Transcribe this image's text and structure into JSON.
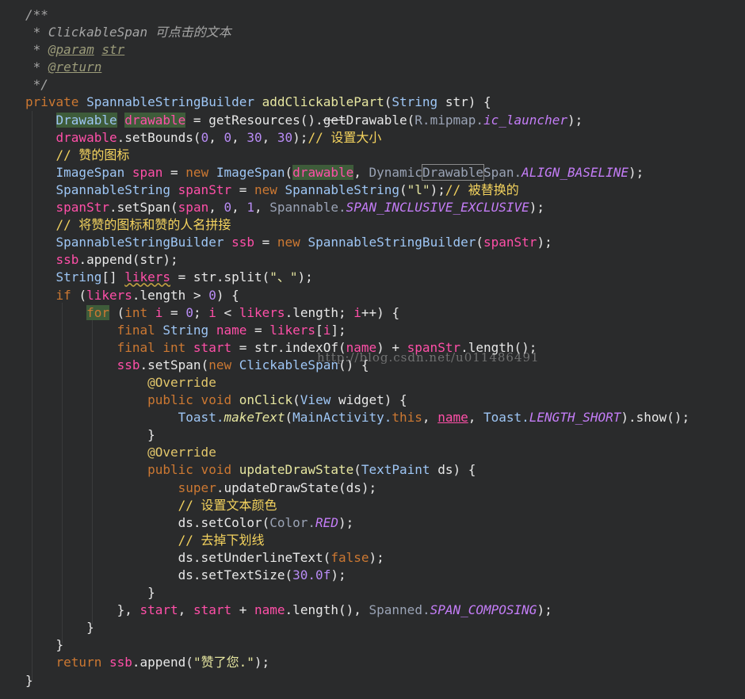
{
  "watermark": "http://blog.csdn.net/u011486491",
  "lines": [
    [
      [
        "c-doc",
        "/**"
      ]
    ],
    [
      [
        "c-doc",
        " * ClickableSpan 可点击的文本"
      ]
    ],
    [
      [
        "c-doc",
        " * "
      ],
      [
        "c-tag",
        "@param"
      ],
      [
        "c-doc",
        " "
      ],
      [
        "c-tag",
        "str"
      ]
    ],
    [
      [
        "c-doc",
        " * "
      ],
      [
        "c-tag",
        "@return"
      ]
    ],
    [
      [
        "c-doc",
        " */"
      ]
    ],
    [
      [
        "c-kw2",
        "private "
      ],
      [
        "c-type",
        "SpannableStringBuilder "
      ],
      [
        "c-fn",
        "addClickablePart"
      ],
      [
        "c-plain",
        "("
      ],
      [
        "c-type",
        "String "
      ],
      [
        "c-plain",
        "str) {"
      ]
    ],
    [
      [
        "c-plain",
        "    "
      ],
      [
        "c-type hl-green",
        "Drawable"
      ],
      [
        "c-plain",
        " "
      ],
      [
        "c-var hl-green",
        "drawable"
      ],
      [
        "c-plain",
        " = getResources()."
      ],
      [
        "c-plain strike",
        "get"
      ],
      [
        "c-plain",
        "Drawable("
      ],
      [
        "c-dim",
        "R.mipmap."
      ],
      [
        "c-const",
        "ic_launcher"
      ],
      [
        "c-plain",
        ");"
      ]
    ],
    [
      [
        "c-plain",
        "    "
      ],
      [
        "c-var",
        "drawable"
      ],
      [
        "c-plain",
        ".setBounds("
      ],
      [
        "c-num",
        "0"
      ],
      [
        "c-plain",
        ", "
      ],
      [
        "c-num",
        "0"
      ],
      [
        "c-plain",
        ", "
      ],
      [
        "c-num",
        "30"
      ],
      [
        "c-plain",
        ", "
      ],
      [
        "c-num",
        "30"
      ],
      [
        "c-plain",
        ");"
      ],
      [
        "c-cmt",
        "// 设置大小"
      ]
    ],
    [
      [
        "c-cmt",
        "    // 赞的图标"
      ]
    ],
    [
      [
        "c-plain",
        "    "
      ],
      [
        "c-type",
        "ImageSpan "
      ],
      [
        "c-var",
        "span"
      ],
      [
        "c-plain",
        " = "
      ],
      [
        "c-kw2",
        "new "
      ],
      [
        "c-type",
        "ImageSpan"
      ],
      [
        "c-plain",
        "("
      ],
      [
        "c-var hl-green",
        "drawable"
      ],
      [
        "c-plain",
        ", "
      ],
      [
        "c-dim",
        "Dynamic"
      ],
      [
        "c-dim hl-box",
        "Drawable"
      ],
      [
        "c-dim",
        "Span."
      ],
      [
        "c-const",
        "ALIGN_BASELINE"
      ],
      [
        "c-plain",
        ");"
      ]
    ],
    [
      [
        "c-plain",
        "    "
      ],
      [
        "c-type",
        "SpannableString "
      ],
      [
        "c-var",
        "spanStr"
      ],
      [
        "c-plain",
        " = "
      ],
      [
        "c-kw2",
        "new "
      ],
      [
        "c-type",
        "SpannableString"
      ],
      [
        "c-plain",
        "("
      ],
      [
        "c-str",
        "\"l\""
      ],
      [
        "c-plain",
        ");"
      ],
      [
        "c-cmt",
        "// 被替换的"
      ]
    ],
    [
      [
        "c-plain",
        "    "
      ],
      [
        "c-var",
        "spanStr"
      ],
      [
        "c-plain",
        ".setSpan("
      ],
      [
        "c-var",
        "span"
      ],
      [
        "c-plain",
        ", "
      ],
      [
        "c-num",
        "0"
      ],
      [
        "c-plain",
        ", "
      ],
      [
        "c-num",
        "1"
      ],
      [
        "c-plain",
        ", "
      ],
      [
        "c-dim",
        "Spannable."
      ],
      [
        "c-const",
        "SPAN_INCLUSIVE_EXCLUSIVE"
      ],
      [
        "c-plain",
        ");"
      ]
    ],
    [
      [
        "c-cmt",
        "    // 将赞的图标和赞的人名拼接"
      ]
    ],
    [
      [
        "c-plain",
        "    "
      ],
      [
        "c-type",
        "SpannableStringBuilder "
      ],
      [
        "c-var",
        "ssb"
      ],
      [
        "c-plain",
        " = "
      ],
      [
        "c-kw2",
        "new "
      ],
      [
        "c-type",
        "SpannableStringBuilder"
      ],
      [
        "c-plain",
        "("
      ],
      [
        "c-var",
        "spanStr"
      ],
      [
        "c-plain",
        ");"
      ]
    ],
    [
      [
        "c-plain",
        "    "
      ],
      [
        "c-var",
        "ssb"
      ],
      [
        "c-plain",
        ".append(str);"
      ]
    ],
    [
      [
        "c-plain",
        "    "
      ],
      [
        "c-type",
        "String"
      ],
      [
        "c-plain",
        "[] "
      ],
      [
        "c-var wavy",
        "likers"
      ],
      [
        "c-plain",
        " = str.split("
      ],
      [
        "c-str",
        "\"、\""
      ],
      [
        "c-plain",
        ");"
      ]
    ],
    [
      [
        "c-plain",
        "    "
      ],
      [
        "c-kw2",
        "if "
      ],
      [
        "c-plain",
        "("
      ],
      [
        "c-var",
        "likers"
      ],
      [
        "c-plain",
        ".length > "
      ],
      [
        "c-num",
        "0"
      ],
      [
        "c-plain",
        ") {"
      ]
    ],
    [
      [
        "c-plain",
        "        "
      ],
      [
        "c-kw2 hl-green",
        "for"
      ],
      [
        "c-plain",
        " ("
      ],
      [
        "c-kw2",
        "int "
      ],
      [
        "c-var",
        "i"
      ],
      [
        "c-plain",
        " = "
      ],
      [
        "c-num",
        "0"
      ],
      [
        "c-plain",
        "; "
      ],
      [
        "c-var",
        "i"
      ],
      [
        "c-plain",
        " < "
      ],
      [
        "c-var",
        "likers"
      ],
      [
        "c-plain",
        ".length; "
      ],
      [
        "c-var",
        "i"
      ],
      [
        "c-plain",
        "++) {"
      ]
    ],
    [
      [
        "c-plain",
        "            "
      ],
      [
        "c-kw2",
        "final "
      ],
      [
        "c-type",
        "String "
      ],
      [
        "c-var",
        "name"
      ],
      [
        "c-plain",
        " = "
      ],
      [
        "c-var",
        "likers"
      ],
      [
        "c-plain",
        "["
      ],
      [
        "c-var",
        "i"
      ],
      [
        "c-plain",
        "];"
      ]
    ],
    [
      [
        "c-plain",
        "            "
      ],
      [
        "c-kw2",
        "final int "
      ],
      [
        "c-var",
        "start"
      ],
      [
        "c-plain",
        " = str.indexOf("
      ],
      [
        "c-var",
        "name"
      ],
      [
        "c-plain",
        ") + "
      ],
      [
        "c-var",
        "spanStr"
      ],
      [
        "c-plain",
        ".length();"
      ]
    ],
    [
      [
        "c-plain",
        "            "
      ],
      [
        "c-var",
        "ssb"
      ],
      [
        "c-plain",
        ".setSpan("
      ],
      [
        "c-kw2",
        "new "
      ],
      [
        "c-type",
        "ClickableSpan"
      ],
      [
        "c-plain",
        "() {"
      ]
    ],
    [
      [
        "c-plain",
        "                "
      ],
      [
        "c-ann",
        "@Override"
      ]
    ],
    [
      [
        "c-plain",
        "                "
      ],
      [
        "c-kw2",
        "public void "
      ],
      [
        "c-fn",
        "onClick"
      ],
      [
        "c-plain",
        "("
      ],
      [
        "c-type",
        "View "
      ],
      [
        "c-plain",
        "widget) {"
      ]
    ],
    [
      [
        "c-plain",
        "                    "
      ],
      [
        "c-type",
        "Toast."
      ],
      [
        "c-meth c-italic",
        "makeText"
      ],
      [
        "c-plain",
        "("
      ],
      [
        "c-type",
        "MainActivity."
      ],
      [
        "c-kw2",
        "this"
      ],
      [
        "c-plain",
        ", "
      ],
      [
        "c-var under",
        "name"
      ],
      [
        "c-plain",
        ", "
      ],
      [
        "c-type",
        "Toast."
      ],
      [
        "c-const",
        "LENGTH_SHORT"
      ],
      [
        "c-plain",
        ").show();"
      ]
    ],
    [
      [
        "c-plain",
        "                }"
      ]
    ],
    [
      [
        "c-plain",
        "                "
      ],
      [
        "c-ann",
        "@Override"
      ]
    ],
    [
      [
        "c-plain",
        "                "
      ],
      [
        "c-kw2",
        "public void "
      ],
      [
        "c-fn",
        "updateDrawState"
      ],
      [
        "c-plain",
        "("
      ],
      [
        "c-type",
        "TextPaint "
      ],
      [
        "c-plain",
        "ds) {"
      ]
    ],
    [
      [
        "c-plain",
        "                    "
      ],
      [
        "c-kw2",
        "super"
      ],
      [
        "c-plain",
        ".updateDrawState(ds);"
      ]
    ],
    [
      [
        "c-cmt",
        "                    // 设置文本颜色"
      ]
    ],
    [
      [
        "c-plain",
        "                    ds.setColor("
      ],
      [
        "c-dim",
        "Color."
      ],
      [
        "c-const",
        "RED"
      ],
      [
        "c-plain",
        ");"
      ]
    ],
    [
      [
        "c-cmt",
        "                    // 去掉下划线"
      ]
    ],
    [
      [
        "c-plain",
        "                    ds.setUnderlineText("
      ],
      [
        "c-kw2",
        "false"
      ],
      [
        "c-plain",
        ");"
      ]
    ],
    [
      [
        "c-plain",
        "                    ds.setTextSize("
      ],
      [
        "c-num",
        "30.0f"
      ],
      [
        "c-plain",
        ");"
      ]
    ],
    [
      [
        "c-plain",
        "                }"
      ]
    ],
    [
      [
        "c-plain",
        "            }, "
      ],
      [
        "c-var",
        "start"
      ],
      [
        "c-plain",
        ", "
      ],
      [
        "c-var",
        "start"
      ],
      [
        "c-plain",
        " + "
      ],
      [
        "c-var",
        "name"
      ],
      [
        "c-plain",
        ".length(), "
      ],
      [
        "c-dim",
        "Spanned."
      ],
      [
        "c-const",
        "SPAN_COMPOSING"
      ],
      [
        "c-plain",
        ");"
      ]
    ],
    [
      [
        "c-plain",
        "        }"
      ]
    ],
    [
      [
        "c-plain",
        "    }"
      ]
    ],
    [
      [
        "c-plain",
        "    "
      ],
      [
        "c-kw2",
        "return "
      ],
      [
        "c-var",
        "ssb"
      ],
      [
        "c-plain",
        ".append("
      ],
      [
        "c-str",
        "\"赞了您.\""
      ],
      [
        "c-plain",
        ");"
      ]
    ],
    [
      [
        "c-plain",
        "}"
      ]
    ]
  ]
}
